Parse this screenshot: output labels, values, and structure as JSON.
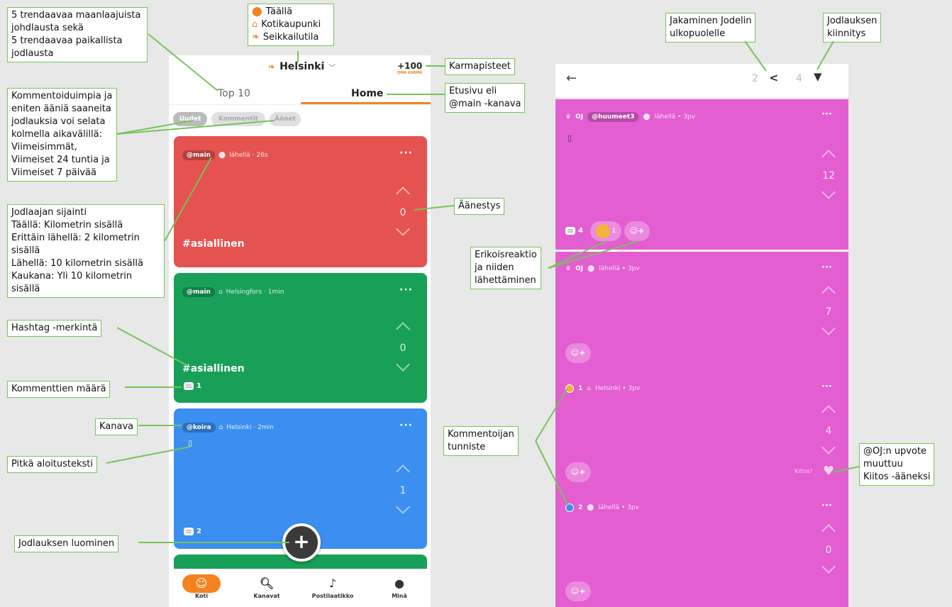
{
  "left_phone": {
    "location_title": "Helsinki",
    "karma_value": "+100",
    "karma_label": "OMA KARMA",
    "tabs": [
      {
        "label": "Top 10"
      },
      {
        "label": "Home"
      }
    ],
    "filters": [
      "Uudet",
      "Kommentit",
      "Äänet"
    ],
    "posts": [
      {
        "channel": "@main",
        "location": "lähellä · 26s",
        "votes": "0",
        "hashtag": "#asiallinen",
        "color": "#e55350"
      },
      {
        "channel": "@main",
        "location": "Helsingfors · 1min",
        "votes": "0",
        "hashtag": "#asiallinen",
        "comments": "1",
        "color": "#18a058"
      },
      {
        "channel": "@koira",
        "location": "Helsinki · 2min",
        "votes": "1",
        "comments": "2",
        "color": "#3b8ff0"
      }
    ],
    "nav": [
      {
        "label": "Koti"
      },
      {
        "label": "Kanavat"
      },
      {
        "label": "Postilaatikko"
      },
      {
        "label": "Minä"
      }
    ],
    "accent_color": "#f4831f"
  },
  "right_phone": {
    "share_count": "2",
    "pin_count": "4",
    "main_post": {
      "author": "OJ",
      "channel": "@huumeet3",
      "location": "lähellä • 3pv",
      "votes": "12",
      "comments": "4",
      "reaction_count": "1"
    },
    "replies": [
      {
        "author": "OJ",
        "location": "lähellä • 3pv",
        "votes": "7"
      },
      {
        "author": "1",
        "location": "Helsinki • 3pv",
        "votes": "4",
        "thanks": "Kiitos!"
      },
      {
        "author": "2",
        "location": "lähellä • 3pv",
        "votes": "0"
      }
    ],
    "color": "#e35ed0"
  },
  "annotations": {
    "trending": "5 trendaavaa maanlaajuista\njohdlausta sekä\n5 trendaavaa paikallista\njodlausta",
    "location_modes": [
      "Täällä",
      "Kotikaupunki",
      "Seikkailutila"
    ],
    "karma": "Karmapisteet",
    "home_feed": "Etusivu eli\n@main -kanava",
    "filter_info": "Kommentoiduimpia ja\neniten ääniä saaneita\njodlauksia voi selata\nkolmella aikavälillä:\nViimeisimmät,\nViimeiset 24 tuntia ja\nViimeiset 7 päivää",
    "location_info": "Jodlaajan sijainti\nTäällä: Kilometrin sisällä\nErittäin lähellä: 2 kilometrin sisällä\nLähellä: 10 kilometrin sisällä\nKaukana: Yli 10 kilometrin sisällä",
    "voting": "Äänestys",
    "hashtag": "Hashtag -merkintä",
    "comment_count": "Kommenttien määrä",
    "channel": "Kanava",
    "long_text": "Pitkä aloitusteksti",
    "create": "Jodlauksen luominen",
    "share": "Jakaminen Jodelin\nulkopuolelle",
    "pin": "Jodlauksen\nkiinnitys",
    "special_reaction": "Erikoisreaktio\nja niiden\nlähettäminen",
    "commenter_id": "Kommentoijan\ntunniste",
    "thanks_vote": "@OJ:n upvote\nmuuttuu\nKiitos -ääneksi"
  }
}
